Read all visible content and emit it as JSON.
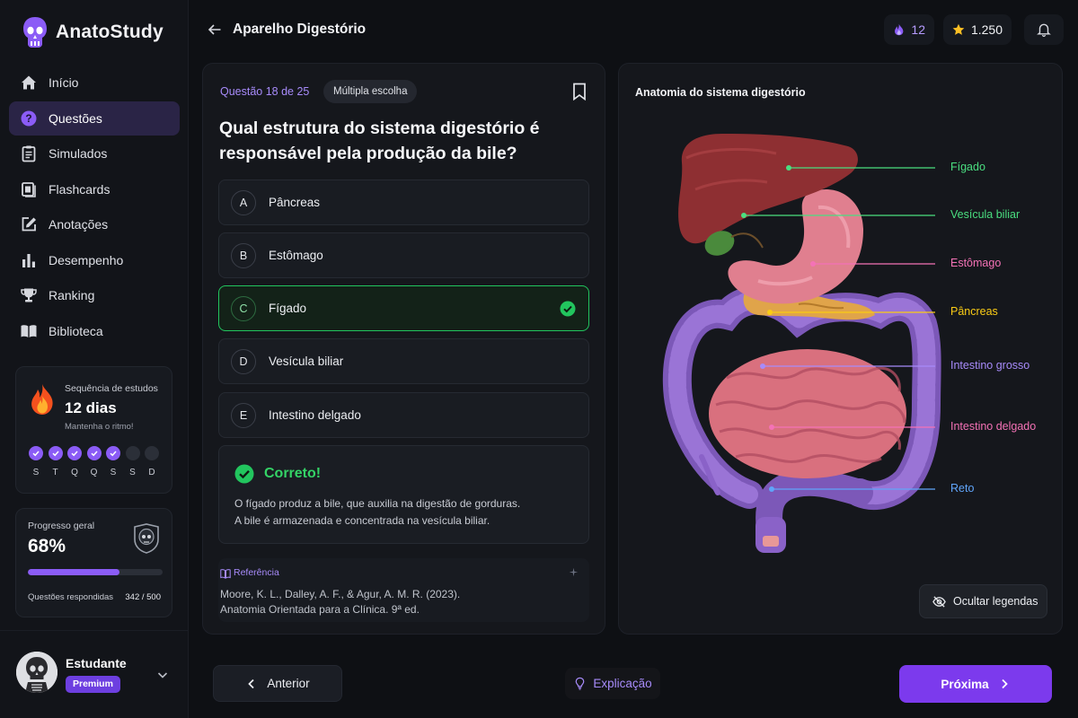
{
  "app": {
    "name": "AnatoStudy"
  },
  "sidebar": {
    "items": [
      {
        "label": "Início",
        "icon": "home-icon"
      },
      {
        "label": "Questões",
        "icon": "question-icon",
        "active": true
      },
      {
        "label": "Simulados",
        "icon": "clipboard-icon"
      },
      {
        "label": "Flashcards",
        "icon": "cards-icon"
      },
      {
        "label": "Anotações",
        "icon": "edit-icon"
      },
      {
        "label": "Desempenho",
        "icon": "bar-chart-icon"
      },
      {
        "label": "Ranking",
        "icon": "trophy-icon"
      },
      {
        "label": "Biblioteca",
        "icon": "book-icon"
      }
    ]
  },
  "streak": {
    "label": "Sequência de estudos",
    "days": "12 dias",
    "subtitle": "Mantenha o ritmo!",
    "week": [
      {
        "letter": "S",
        "done": true
      },
      {
        "letter": "T",
        "done": true
      },
      {
        "letter": "Q",
        "done": true
      },
      {
        "letter": "Q",
        "done": true
      },
      {
        "letter": "S",
        "done": true
      },
      {
        "letter": "S",
        "done": false
      },
      {
        "letter": "D",
        "done": false
      }
    ]
  },
  "progress": {
    "label": "Progresso geral",
    "value": "68%",
    "fraction": 0.68,
    "answered_label": "Questões respondidas",
    "answered_value": "342 / 500"
  },
  "user": {
    "name": "Estudante",
    "badge": "Premium"
  },
  "header": {
    "title": "Aparelho Digestório",
    "fire_count": "12",
    "stars": "1.250"
  },
  "question": {
    "counter": "Questão 18 de 25",
    "type": "Múltipla escolha",
    "text": "Qual estrutura do sistema digestório é responsável pela produção da bile?",
    "options": [
      {
        "letter": "A",
        "text": "Pâncreas",
        "correct": false
      },
      {
        "letter": "B",
        "text": "Estômago",
        "correct": false
      },
      {
        "letter": "C",
        "text": "Fígado",
        "correct": true
      },
      {
        "letter": "D",
        "text": "Vesícula biliar",
        "correct": false
      },
      {
        "letter": "E",
        "text": "Intestino delgado",
        "correct": false
      }
    ],
    "feedback": {
      "title": "Correto!",
      "line1": "O fígado produz a bile, que auxilia na digestão de gorduras.",
      "line2": "A bile é armazenada e concentrada na vesícula biliar."
    },
    "reference": {
      "label": "Referência",
      "line1": "Moore, K. L., Dalley, A. F., & Agur, A. M. R. (2023).",
      "line2": "Anatomia Orientada para a Clínica. 9ª ed."
    }
  },
  "anatomy": {
    "title": "Anatomia do sistema digestório",
    "legends": [
      {
        "label": "Fígado",
        "color": "#4ade80"
      },
      {
        "label": "Vesícula biliar",
        "color": "#4ade80"
      },
      {
        "label": "Estômago",
        "color": "#f472b6"
      },
      {
        "label": "Pâncreas",
        "color": "#facc15"
      },
      {
        "label": "Intestino grosso",
        "color": "#a78bfa"
      },
      {
        "label": "Intestino delgado",
        "color": "#f472b6"
      },
      {
        "label": "Reto",
        "color": "#60a5fa"
      }
    ],
    "hide_label": "Ocultar legendas"
  },
  "footer": {
    "prev": "Anterior",
    "explain": "Explicação",
    "next": "Próxima"
  },
  "colors": {
    "accent": "#8b5cf6",
    "correct": "#22c55e",
    "panel": "#15171c"
  }
}
